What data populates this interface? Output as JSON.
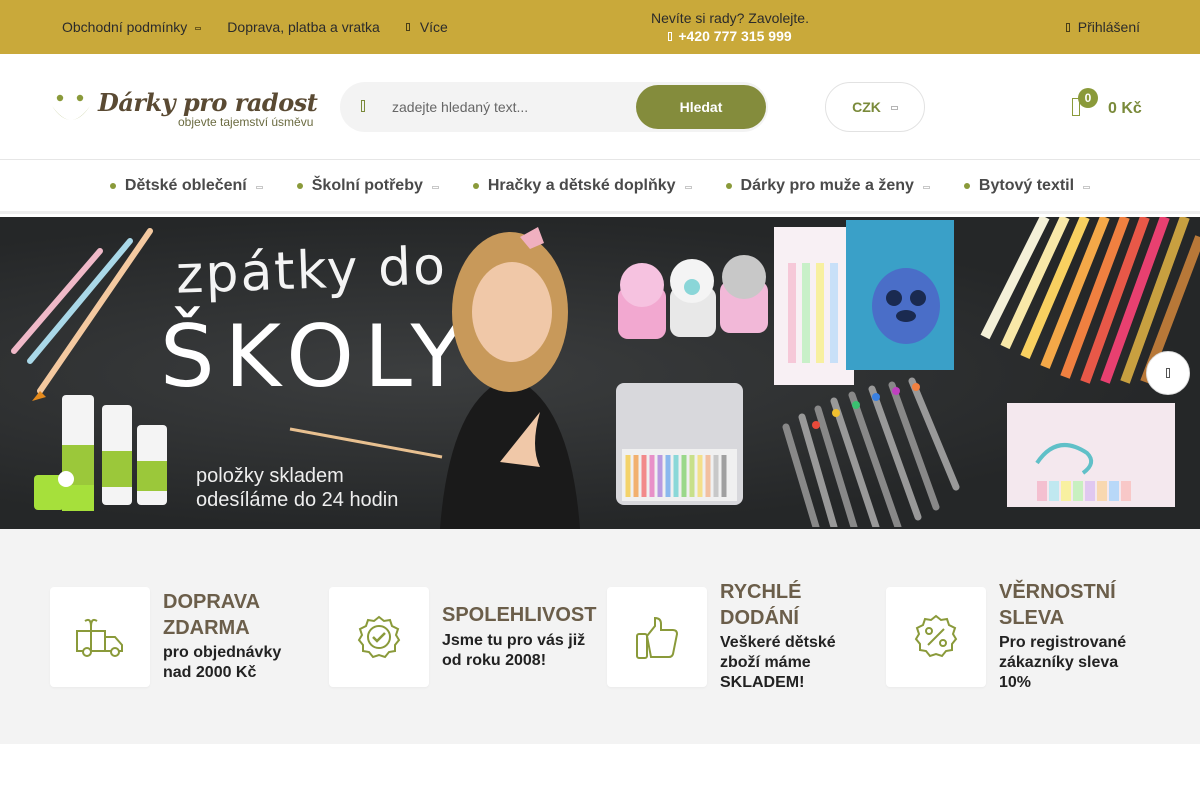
{
  "topbar": {
    "links": [
      {
        "label": "Obchodní podmínky"
      },
      {
        "label": "Doprava, platba a vratka"
      },
      {
        "label": "Více"
      }
    ],
    "contact_text": "Nevíte si rady? Zavolejte.",
    "phone": "+420 777 315 999",
    "login": "Přihlášení"
  },
  "logo": {
    "brand": "Dárky pro radost",
    "tagline": "objevte tajemství úsměvu"
  },
  "search": {
    "placeholder": "zadejte hledaný text...",
    "button": "Hledat"
  },
  "currency": {
    "selected": "CZK"
  },
  "cart": {
    "count": "0",
    "total": "0 Kč"
  },
  "categories": [
    {
      "label": "Dětské oblečení"
    },
    {
      "label": "Školní potřeby"
    },
    {
      "label": "Hračky a dětské doplňky"
    },
    {
      "label": "Dárky pro muže a ženy"
    },
    {
      "label": "Bytový textil"
    }
  ],
  "banner": {
    "line1": "zpátky do",
    "line2": "ŠKOLY",
    "line3": "položky skladem",
    "line4": "odesíláme do 24 hodin",
    "active_slide": 1
  },
  "features": [
    {
      "icon": "delivery-truck-icon",
      "title": [
        "DOPRAVA",
        "ZDARMA"
      ],
      "desc": [
        "pro objednávky",
        "nad 2000 Kč"
      ]
    },
    {
      "icon": "quality-badge-icon",
      "title": [
        "SPOLEHLIVOST"
      ],
      "desc": [
        "Jsme tu pro vás již",
        "od roku 2008!"
      ]
    },
    {
      "icon": "thumbs-up-icon",
      "title": [
        "RYCHLÉ",
        "DODÁNÍ"
      ],
      "desc": [
        "Veškeré dětské",
        "zboží máme",
        "SKLADEM!"
      ]
    },
    {
      "icon": "discount-badge-icon",
      "title": [
        "VĚRNOSTNÍ",
        "SLEVA"
      ],
      "desc": [
        "Pro registrované",
        "zákazníky sleva",
        "10%"
      ]
    }
  ],
  "colors": {
    "topbar_bg": "#c9a93a",
    "accent_green": "#848c3c",
    "feature_title": "#6b5e4a"
  }
}
